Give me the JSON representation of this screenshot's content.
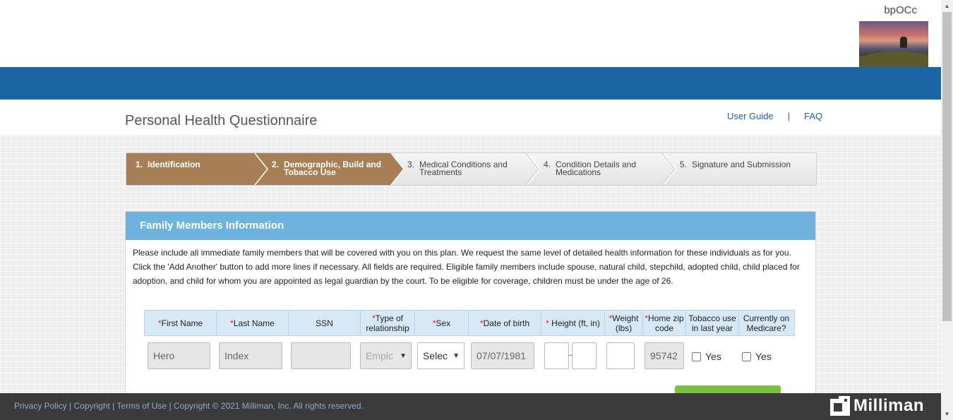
{
  "header": {
    "username": "bpOCc"
  },
  "title_bar": {
    "title": "Personal Health Questionnaire",
    "user_guide": "User Guide",
    "separator": "|",
    "faq": "FAQ"
  },
  "steps": [
    {
      "num": "1.",
      "label": "Identification",
      "state": "completed"
    },
    {
      "num": "2.",
      "label": "Demographic, Build and Tobacco Use",
      "state": "current"
    },
    {
      "num": "3.",
      "label": "Medical Conditions and Treatments",
      "state": "pending"
    },
    {
      "num": "4.",
      "label": "Condition Details and Medications",
      "state": "pending"
    },
    {
      "num": "5.",
      "label": "Signature and Submission",
      "state": "pending"
    }
  ],
  "panel": {
    "title": "Family Members Information",
    "description": "Please include all immediate family members that will be covered with you on this plan. We request the same level of detailed health information for these individuals as for you. Click the 'Add Another' button to add more lines if necessary. All fields are required. Eligible family members include spouse, natural child, stepchild, adopted child, child placed for adoption, and child for whom you are appointed as legal guardian by the court. To be eligible for coverage, children must be under the age of 26."
  },
  "table": {
    "columns": [
      {
        "label": "First Name",
        "required": "*"
      },
      {
        "label": "Last Name",
        "required": "*"
      },
      {
        "label": "SSN",
        "required": ""
      },
      {
        "label": "Type of relationship",
        "required": "*"
      },
      {
        "label": "Sex",
        "required": "*"
      },
      {
        "label": "Date of birth",
        "required": "*"
      },
      {
        "label": " Height (ft, in)",
        "required": "*"
      },
      {
        "label": "Weight (lbs)",
        "required": "*"
      },
      {
        "label": "Home zip code",
        "required": "*"
      },
      {
        "label": "Tobacco use in last year",
        "required": ""
      },
      {
        "label": "Currently on Medicare?",
        "required": ""
      }
    ],
    "row": {
      "first_name": "Hero",
      "last_name": "Index",
      "ssn": "",
      "relationship": "Emplc",
      "sex": "Selec",
      "dob": "07/07/1981",
      "height_ft": "",
      "height_in": "",
      "weight": "",
      "zip": "95742",
      "tobacco_label": "Yes",
      "medicare_label": "Yes"
    }
  },
  "footer": {
    "privacy": "Privacy Policy",
    "copyright_link": "Copyright",
    "terms": "Terms of Use",
    "notice": "Copyright © 2021 Milliman, Inc. All rights reserved.",
    "brand": "Milliman"
  },
  "colors": {
    "brand_blue": "#1a65a3",
    "step_active": "#a67f56",
    "panel_header": "#6db3dd",
    "footer_bg": "#3b3b3b",
    "required": "#e02020",
    "action_green": "#7cc242"
  }
}
